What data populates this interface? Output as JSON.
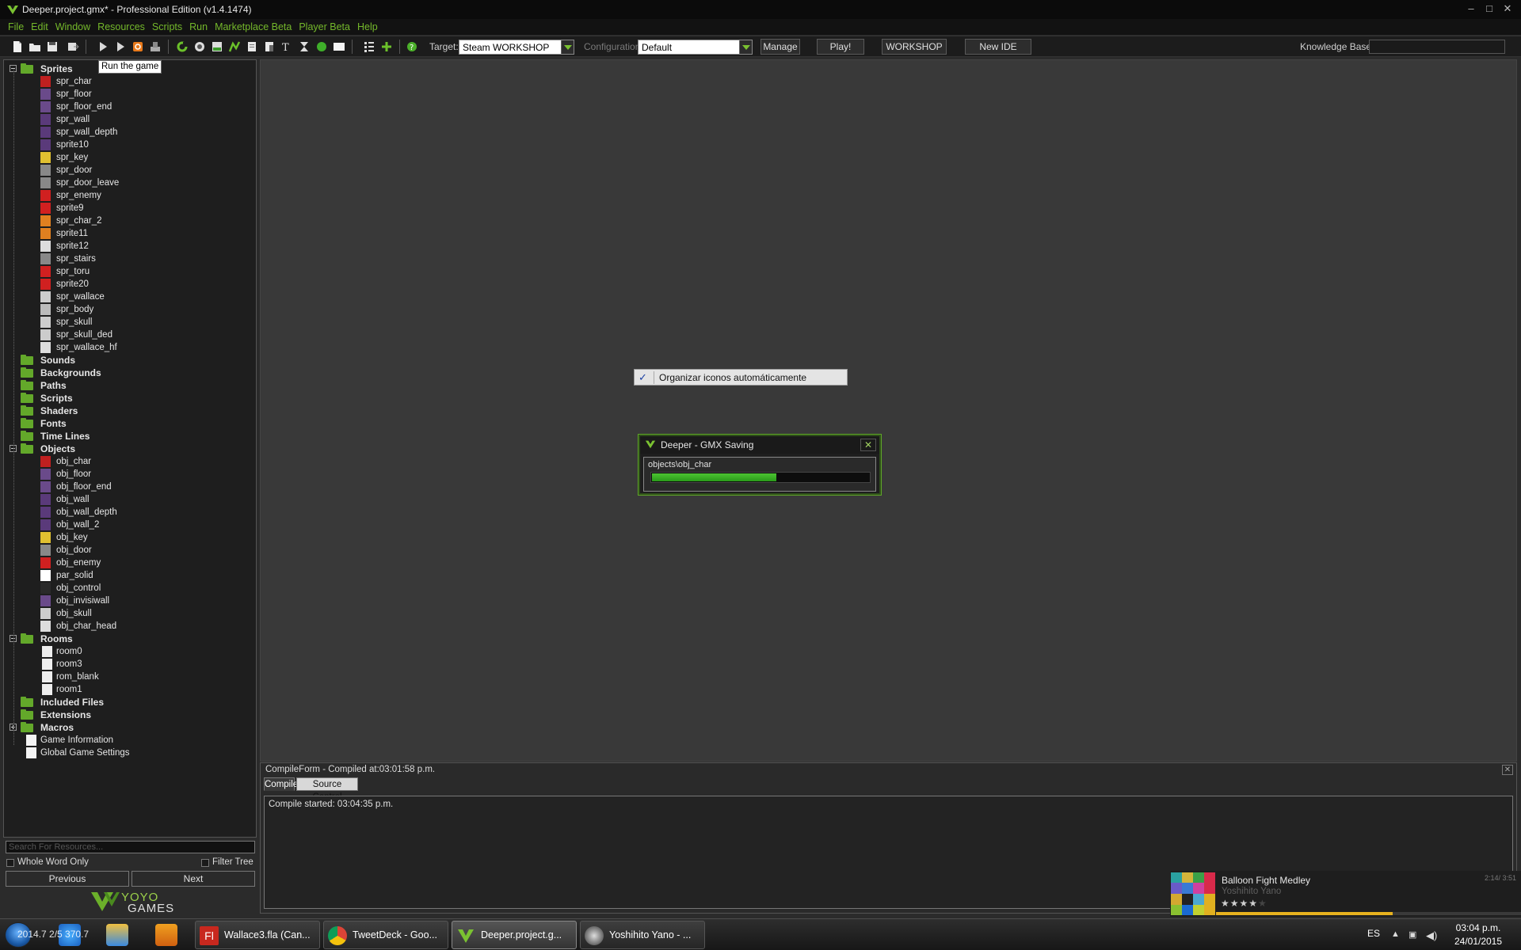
{
  "window": {
    "title": "Deeper.project.gmx*  -  Professional Edition (v1.4.1474)"
  },
  "menu": [
    "File",
    "Edit",
    "Window",
    "Resources",
    "Scripts",
    "Run",
    "Marketplace Beta",
    "Player Beta",
    "Help"
  ],
  "toolbar": {
    "target_label": "Target:",
    "target_value": "Steam WORKSHOP",
    "config_label": "Configuration:",
    "config_value": "Default",
    "manage_label": "Manage",
    "play_label": "Play!",
    "workshop_label": "WORKSHOP",
    "newide_label": "New IDE",
    "kb_label": "Knowledge Base:",
    "kb_value": "",
    "tooltip": "Run the game"
  },
  "tree": {
    "sprites_label": "Sprites",
    "sprites": [
      "spr_char",
      "spr_floor",
      "spr_floor_end",
      "spr_wall",
      "spr_wall_depth",
      "sprite10",
      "spr_key",
      "spr_door",
      "spr_door_leave",
      "spr_enemy",
      "sprite9",
      "spr_char_2",
      "sprite11",
      "sprite12",
      "spr_stairs",
      "spr_toru",
      "sprite20",
      "spr_wallace",
      "spr_body",
      "spr_skull",
      "spr_skull_ded",
      "spr_wallace_hf"
    ],
    "folders_mid": [
      "Sounds",
      "Backgrounds",
      "Paths",
      "Scripts",
      "Shaders",
      "Fonts",
      "Time Lines"
    ],
    "objects_label": "Objects",
    "objects": [
      "obj_char",
      "obj_floor",
      "obj_floor_end",
      "obj_wall",
      "obj_wall_depth",
      "obj_wall_2",
      "obj_key",
      "obj_door",
      "obj_enemy",
      "par_solid",
      "obj_control",
      "obj_invisiwall",
      "obj_skull",
      "obj_char_head"
    ],
    "rooms_label": "Rooms",
    "rooms": [
      "room0",
      "room3",
      "rom_blank",
      "room1"
    ],
    "folders_end": [
      "Included Files",
      "Extensions",
      "Macros"
    ],
    "game_info": "Game Information",
    "global_settings": "Global Game Settings",
    "search_placeholder": "Search For Resources...",
    "whole_word": "Whole Word Only",
    "filter_tree": "Filter Tree",
    "previous": "Previous",
    "next": "Next",
    "logo_text_1": "YOYO",
    "logo_text_2": "GAMES"
  },
  "context_item": "Organizar iconos automáticamente",
  "save_dialog": {
    "title": "Deeper - GMX Saving",
    "path": "objects\\obj_char",
    "progress": 0.57
  },
  "compile": {
    "title": "CompileForm - Compiled at:03:01:58 p.m.",
    "tab_compile": "Compile",
    "tab_source": "Source Control",
    "output": "Compile started: 03:04:35 p.m."
  },
  "now_playing": {
    "title": "Balloon Fight Medley",
    "artist": "Yoshihito Yano",
    "time": "2:14/ 3:51",
    "stars": "★★★★★",
    "progress": 0.58
  },
  "taskbar": {
    "quick_overlay": "2014.7 2/5 370.7",
    "tasks": [
      "Wallace3.fla (Can...",
      "TweetDeck - Goo...",
      "Deeper.project.g...",
      "Yoshihito Yano - ..."
    ],
    "lang": "ES",
    "time": "03:04 p.m.",
    "date": "24/01/2015"
  },
  "colors": {
    "accent_green": "#74b82b",
    "progress_green": "#3fb52a",
    "workspace": "#393939"
  }
}
